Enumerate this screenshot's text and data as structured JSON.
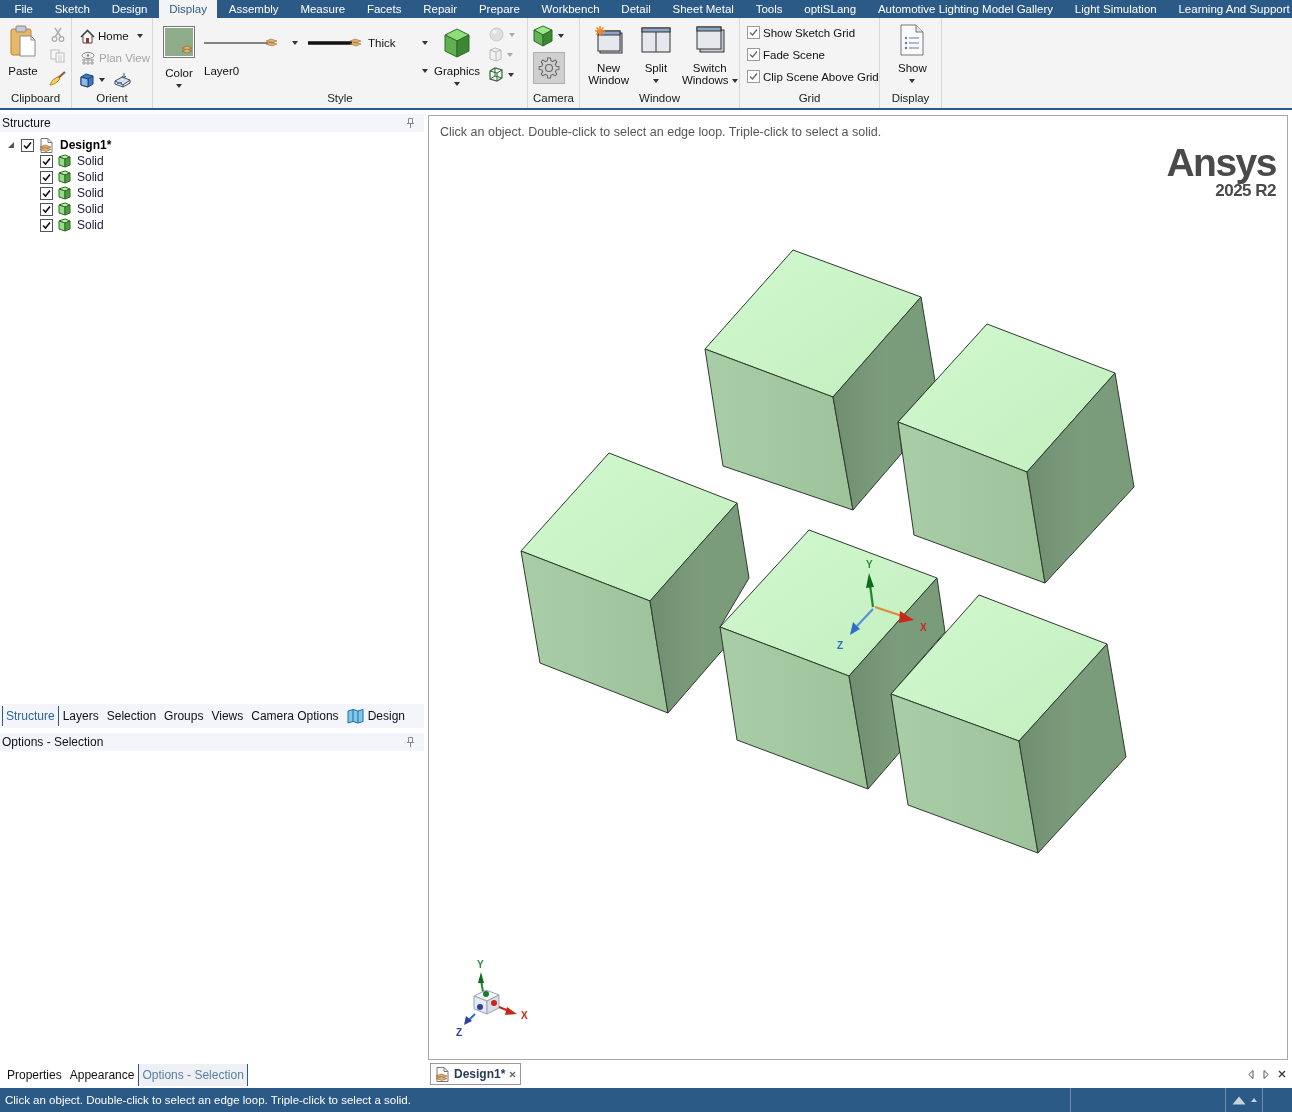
{
  "menu_tabs": [
    {
      "label": "File",
      "selected": false
    },
    {
      "label": "Sketch",
      "selected": false
    },
    {
      "label": "Design",
      "selected": false
    },
    {
      "label": "Display",
      "selected": true
    },
    {
      "label": "Assembly",
      "selected": false
    },
    {
      "label": "Measure",
      "selected": false
    },
    {
      "label": "Facets",
      "selected": false
    },
    {
      "label": "Repair",
      "selected": false
    },
    {
      "label": "Prepare",
      "selected": false
    },
    {
      "label": "Workbench",
      "selected": false
    },
    {
      "label": "Detail",
      "selected": false
    },
    {
      "label": "Sheet Metal",
      "selected": false
    },
    {
      "label": "Tools",
      "selected": false
    },
    {
      "label": "optiSLang",
      "selected": false
    },
    {
      "label": "Automotive Lighting Model Gallery",
      "selected": false
    },
    {
      "label": "Light Simulation",
      "selected": false
    },
    {
      "label": "Learning And Support",
      "selected": false
    }
  ],
  "ribbon": {
    "clipboard": {
      "label": "Clipboard",
      "paste": "Paste",
      "tools": [
        {
          "kind": "cut",
          "disabled": true
        },
        {
          "kind": "copy",
          "disabled": true
        },
        {
          "kind": "painter",
          "disabled": false
        }
      ]
    },
    "orient": {
      "label": "Orient",
      "items": [
        {
          "kind": "home",
          "label": "Home",
          "disabled": false
        },
        {
          "kind": "plan",
          "label": "Plan View",
          "disabled": true
        }
      ]
    },
    "style": {
      "label": "Style",
      "color_label": "Color",
      "color": "#8fac8a",
      "layer": "Layer0",
      "line_weight": "Thick",
      "graphics": "Graphics"
    },
    "camera": {
      "label": "Camera",
      "settings": {
        "on": true
      }
    },
    "window": {
      "label": "Window",
      "buttons": [
        {
          "kind": "new",
          "label": "New Window"
        },
        {
          "kind": "split",
          "label": "Split"
        },
        {
          "kind": "switch",
          "label": "Switch Windows"
        }
      ]
    },
    "grid": {
      "label": "Grid",
      "options": [
        {
          "label": "Show Sketch Grid",
          "checked": true
        },
        {
          "label": "Fade Scene",
          "checked": true
        },
        {
          "label": "Clip Scene Above Grid",
          "checked": true
        }
      ]
    },
    "display": {
      "label": "Display",
      "show": "Show"
    }
  },
  "structure_panel": {
    "title": "Structure",
    "tree": [
      {
        "kind": "design",
        "label": "Design1*",
        "checked": true,
        "expanded": true,
        "children": [
          {
            "kind": "solid",
            "label": "Solid",
            "checked": true
          },
          {
            "kind": "solid",
            "label": "Solid",
            "checked": true
          },
          {
            "kind": "solid",
            "label": "Solid",
            "checked": true
          },
          {
            "kind": "solid",
            "label": "Solid",
            "checked": true
          },
          {
            "kind": "solid",
            "label": "Solid",
            "checked": true
          }
        ]
      }
    ]
  },
  "panel_tabs": [
    {
      "kind": "text",
      "label": "Structure",
      "selected": true
    },
    {
      "kind": "text",
      "label": "Layers",
      "selected": false
    },
    {
      "kind": "text",
      "label": "Selection",
      "selected": false
    },
    {
      "kind": "text",
      "label": "Groups",
      "selected": false
    },
    {
      "kind": "text",
      "label": "Views",
      "selected": false
    },
    {
      "kind": "text",
      "label": "Camera Options",
      "selected": false
    },
    {
      "kind": "map",
      "label": "Design",
      "selected": false
    }
  ],
  "options_panel": {
    "title": "Options - Selection"
  },
  "bottom_tabs": [
    {
      "label": "Properties",
      "selected": false
    },
    {
      "label": "Appearance",
      "selected": false
    },
    {
      "label": "Options - Selection",
      "selected": true
    }
  ],
  "viewport": {
    "hint": "Click an object. Double-click to select an edge loop. Triple-click to select a solid.",
    "logo": {
      "brand": "Ansys",
      "version": "2025 R2"
    },
    "triad": {
      "x": "X",
      "y": "Y",
      "z": "Z"
    },
    "corner_triad": {
      "x": "X",
      "y": "Y",
      "z": "Z"
    }
  },
  "document_tabs": [
    {
      "label": "Design1*",
      "selected": true
    }
  ],
  "status_bar": {
    "message": "Click an object. Double-click to select an edge loop. Triple-click to select a solid."
  }
}
